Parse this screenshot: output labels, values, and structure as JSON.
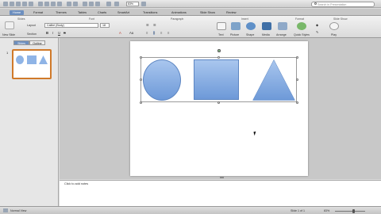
{
  "toolbar": {
    "zoom_value": "83%",
    "search_placeholder": "Search in Presentation"
  },
  "tabs": [
    {
      "label": "Home"
    },
    {
      "label": "Format"
    },
    {
      "label": "Themes"
    },
    {
      "label": "Tables"
    },
    {
      "label": "Charts"
    },
    {
      "label": "SmartArt"
    },
    {
      "label": "Transitions"
    },
    {
      "label": "Animations"
    },
    {
      "label": "Slide Show"
    },
    {
      "label": "Review"
    }
  ],
  "ribbon": {
    "groups": {
      "slides": "Slides",
      "font": "Font",
      "paragraph": "Paragraph",
      "insert": "Insert",
      "format": "Format",
      "slide_show": "Slide Show"
    },
    "new_slide_label": "New Slide",
    "layout_label": "Layout",
    "section_label": "Section",
    "font_name": "Calibri (Body)",
    "font_size": "18",
    "buttons": {
      "text": "Text",
      "picture": "Picture",
      "shape": "Shape",
      "media": "Media",
      "arrange": "Arrange",
      "quick_styles": "Quick Styles",
      "play": "Play"
    }
  },
  "sidebar": {
    "tab_slides": "Slides",
    "tab_outline": "Outline",
    "slide_number": "1"
  },
  "notes": {
    "placeholder": "Click to add notes"
  },
  "status": {
    "view": "Normal View",
    "slide_info": "Slide 1 of 1",
    "zoom": "83%"
  },
  "colors": {
    "shape_fill_top": "#a9c6ee",
    "shape_fill_bottom": "#6d99d8",
    "active_tab": "#6d8fbf",
    "thumbnail_selection": "#d07a2a"
  }
}
